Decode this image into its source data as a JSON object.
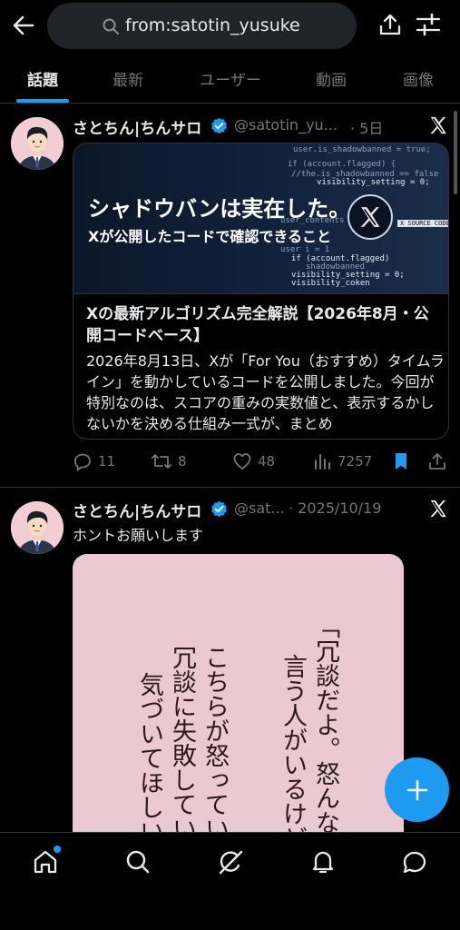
{
  "search": {
    "query": "from:satotin_yusuke"
  },
  "icons": {
    "back": "arrow-left-icon",
    "search": "search-icon",
    "share": "share-icon",
    "filter": "sliders-icon",
    "verified": "verified-badge-icon",
    "platform": "x-logo-icon",
    "reply": "reply-icon",
    "repost": "repost-icon",
    "like": "heart-icon",
    "views": "bar-chart-icon",
    "bookmark": "bookmark-icon",
    "compose": "plus-icon"
  },
  "tabs": [
    {
      "label": "話題",
      "active": true
    },
    {
      "label": "最新",
      "active": false
    },
    {
      "label": "ユーザー",
      "active": false
    },
    {
      "label": "動画",
      "active": false
    },
    {
      "label": "画像",
      "active": false
    }
  ],
  "tweets": [
    {
      "name": "さとちん|ちんサロ",
      "handle": "@satotin_yu...",
      "time": "· 5日",
      "card": {
        "image_headline": "シャドウバンは実在した。",
        "image_subline": "Xが公開したコードで確認できること",
        "image_badge": "X SOURCE CODE",
        "code_lines": [
          "user.is_shadowbanned = true;",
          "if (account.flagged) {",
          "//the.is_shadowbanned == false",
          "visibility_setting = 0;",
          "user_contents + ...",
          "user i = 1",
          "if (account.flagged)",
          "shadowbanned",
          "visibility_setting = 0;",
          "visibility_coken"
        ],
        "title": "Xの最新アルゴリズム完全解説【2026年8月・公開コードベース】",
        "description": "2026年8月13日、Xが「For You（おすすめ）タイムライン」を動かしているコードを公開しました。今回が特別なのは、スコアの重みの実数値と、表示するかしないかを決める仕組み一式が、まとめ"
      },
      "stats": {
        "replies": "11",
        "reposts": "8",
        "likes": "48",
        "views": "7257"
      },
      "bookmarked": true
    },
    {
      "name": "さとちん|ちんサロ",
      "handle": "@sat...",
      "time": "· 2025/10/19",
      "text": "ホントお願いします",
      "image_columns": [
        "「冗談だよ。怒んなよ」",
        "言う人がいるけど",
        "こちらが怒っているなら",
        "冗談に失敗している",
        "気づいてほしい"
      ]
    }
  ],
  "bottom_nav": [
    {
      "name": "home-icon",
      "badge": true
    },
    {
      "name": "search-icon",
      "badge": false
    },
    {
      "name": "grok-icon",
      "badge": false
    },
    {
      "name": "bell-icon",
      "badge": false
    },
    {
      "name": "message-icon",
      "badge": false
    }
  ],
  "colors": {
    "accent": "#1d9bf0",
    "background": "#000000",
    "muted": "#71767b",
    "text": "#e7e9ea"
  }
}
